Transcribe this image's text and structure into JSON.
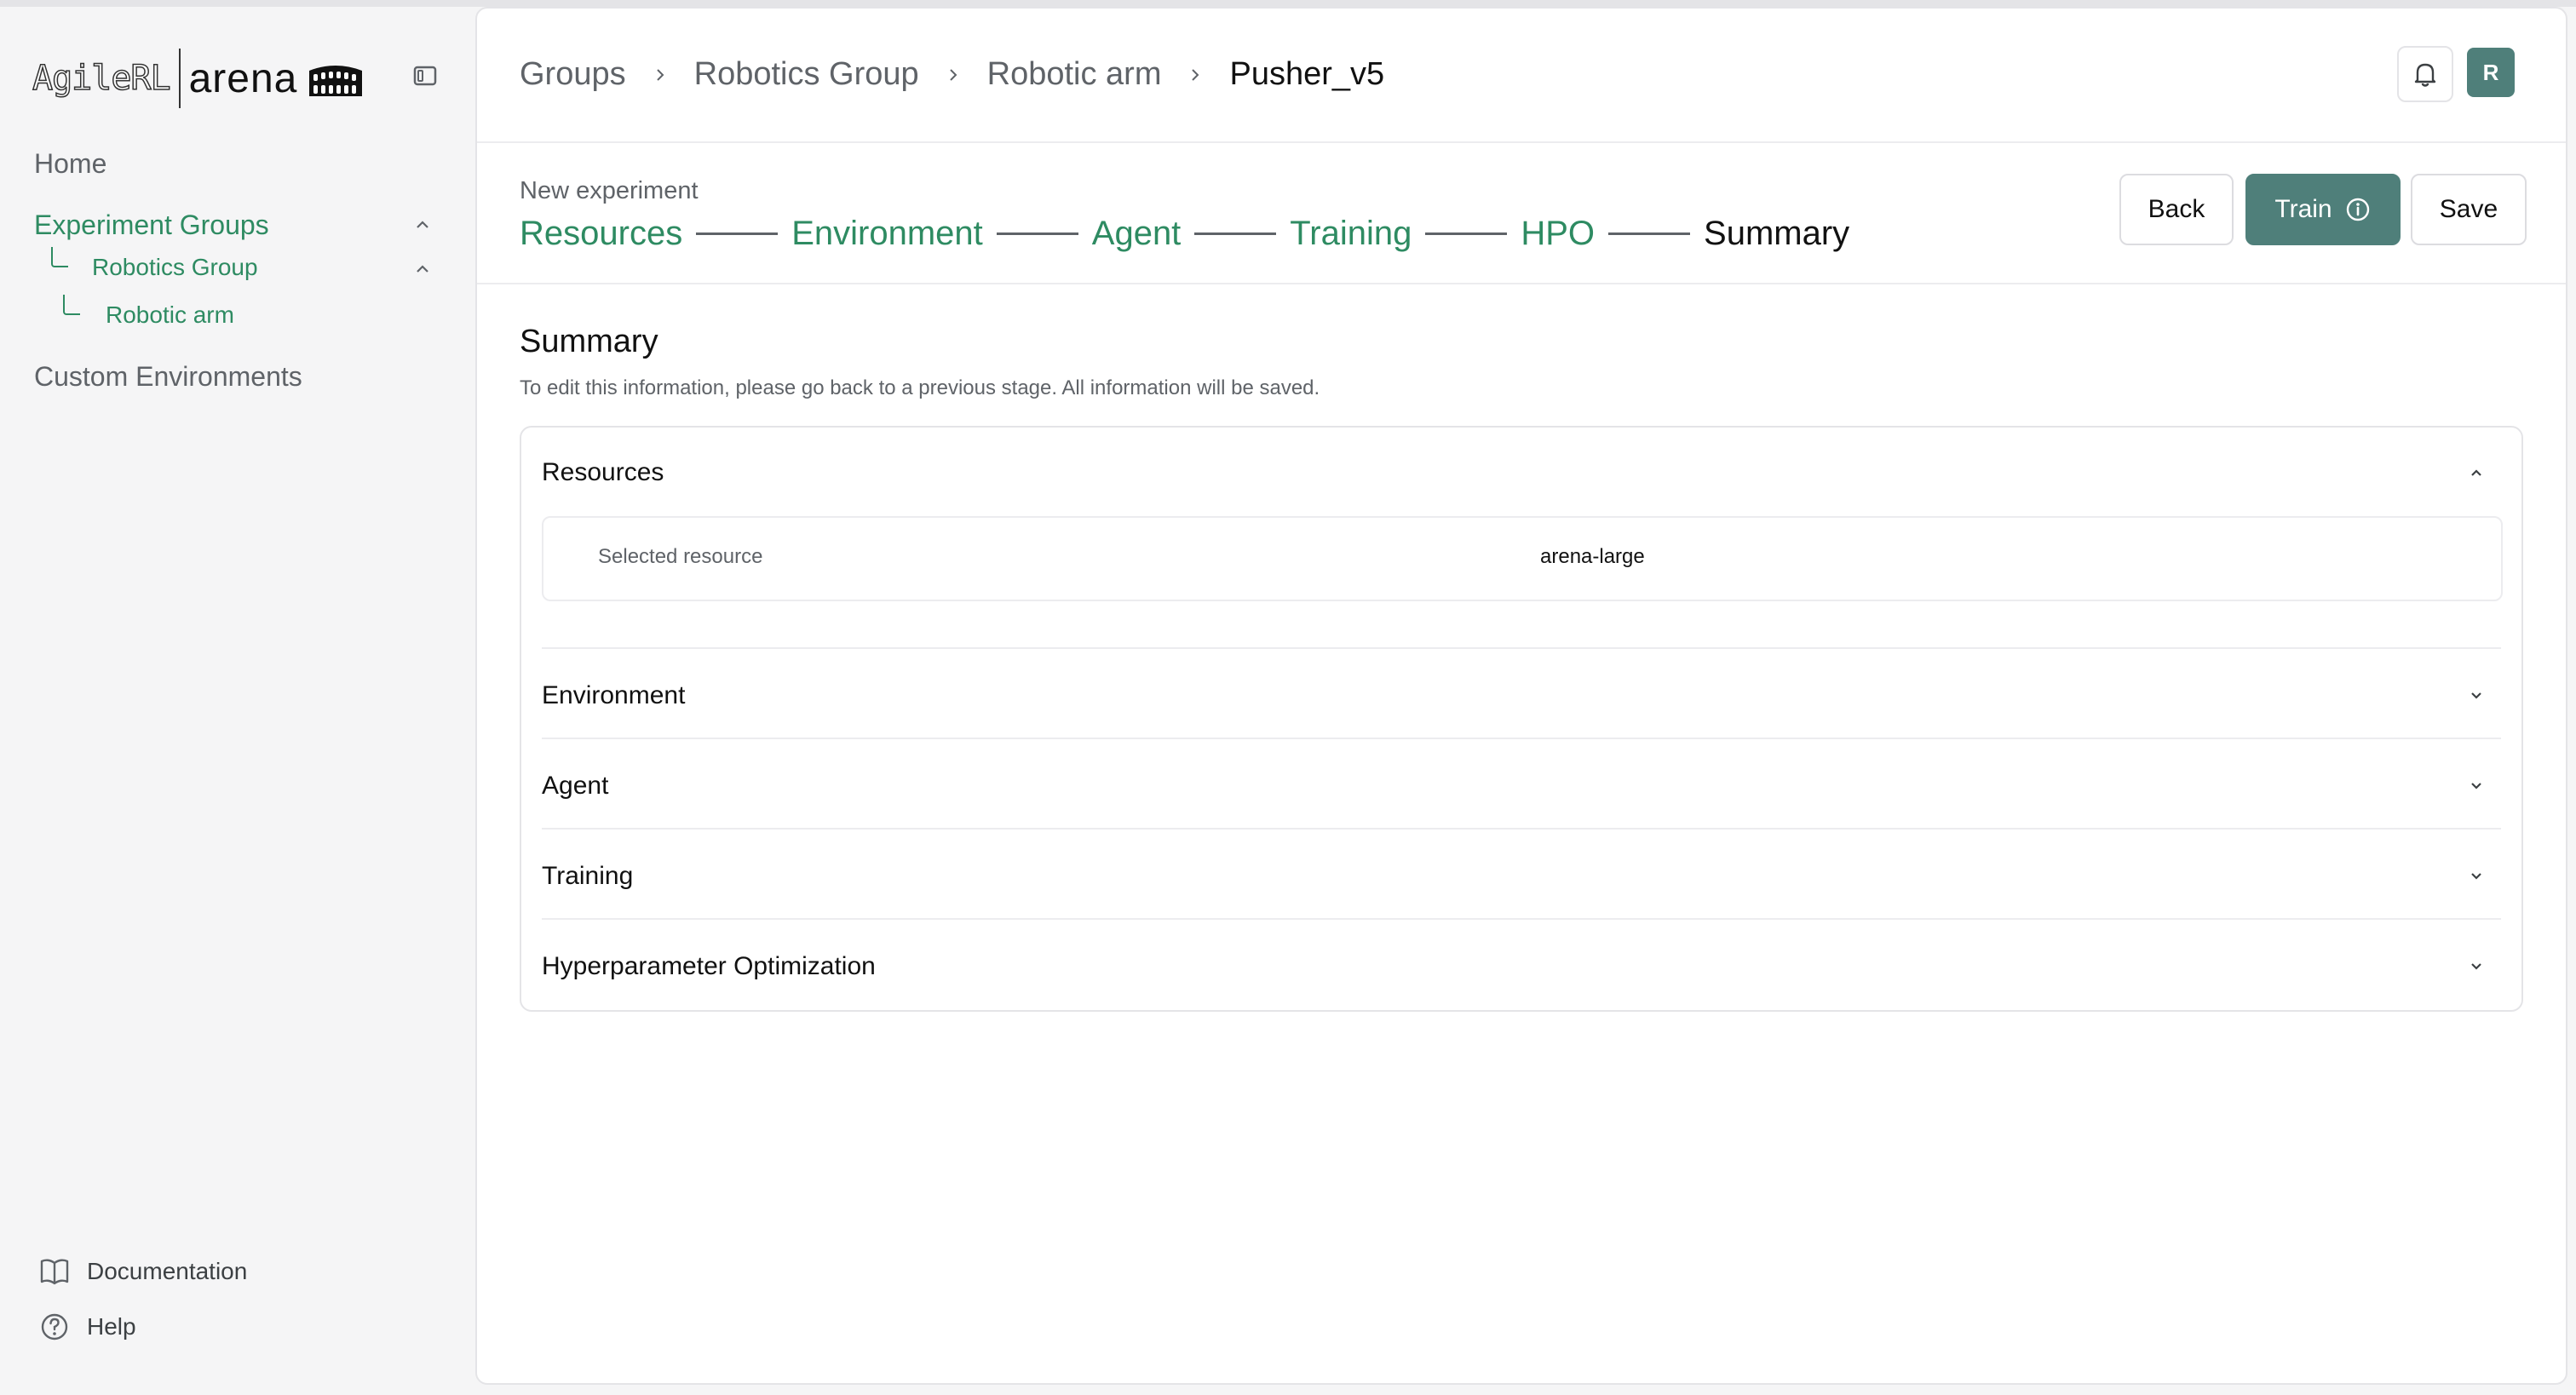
{
  "brand": {
    "logo_left": "AgileRL",
    "logo_right": "arena"
  },
  "sidebar": {
    "home": "Home",
    "experiment_groups": "Experiment Groups",
    "robotics_group": "Robotics Group",
    "robotic_arm": "Robotic arm",
    "custom_environments": "Custom Environments",
    "documentation": "Documentation",
    "help": "Help"
  },
  "breadcrumb": [
    "Groups",
    "Robotics Group",
    "Robotic arm",
    "Pusher_v5"
  ],
  "header": {
    "avatar_initial": "R"
  },
  "stepper": {
    "caption": "New experiment",
    "steps": [
      "Resources",
      "Environment",
      "Agent",
      "Training",
      "HPO",
      "Summary"
    ],
    "active_step": "Summary"
  },
  "actions": {
    "back": "Back",
    "train": "Train",
    "save": "Save"
  },
  "summary": {
    "title": "Summary",
    "description": "To edit this information, please go back to a previous stage. All information will be saved.",
    "sections": [
      {
        "title": "Resources",
        "expanded": true
      },
      {
        "title": "Environment",
        "expanded": false
      },
      {
        "title": "Agent",
        "expanded": false
      },
      {
        "title": "Training",
        "expanded": false
      },
      {
        "title": "Hyperparameter Optimization",
        "expanded": false
      }
    ],
    "resources": {
      "label": "Selected resource",
      "value": "arena-large"
    }
  },
  "colors": {
    "accent_green": "#2e8b62",
    "primary_button": "#4f7f7a"
  }
}
